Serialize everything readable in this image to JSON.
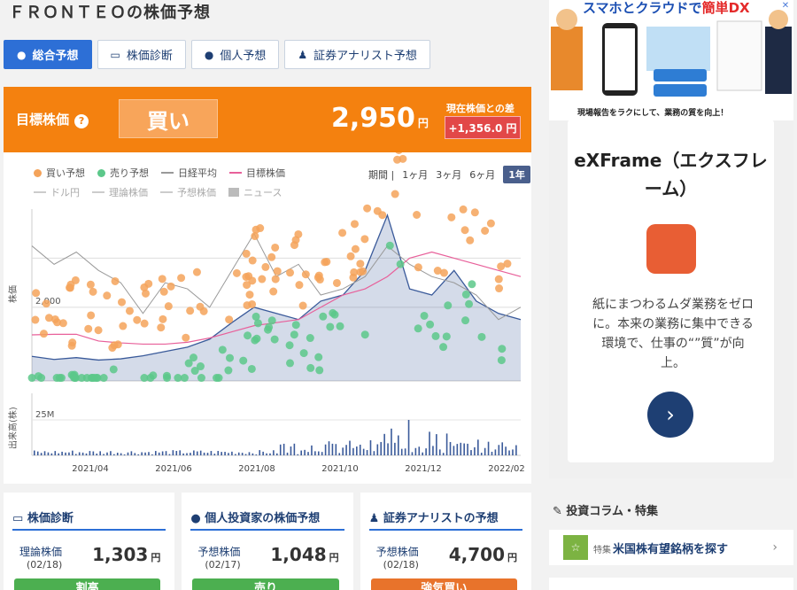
{
  "page_title": "ＦＲＯＮＴＥＯの株価予想",
  "tabs": [
    {
      "label": "総合予想",
      "icon": "chat-icon"
    },
    {
      "label": "株価診断",
      "icon": "monitor-icon"
    },
    {
      "label": "個人予想",
      "icon": "chat-icon"
    },
    {
      "label": "証券アナリスト予想",
      "icon": "people-icon"
    }
  ],
  "target": {
    "label": "目標株価",
    "help": "?",
    "rating": "買い",
    "price": "2,950",
    "yen": "円",
    "diff_label": "現在株価との差",
    "diff": "+1,356.0 円"
  },
  "legend": {
    "row1": [
      "買い予想",
      "売り予想",
      "日経平均",
      "目標株価"
    ],
    "row2": [
      "ドル円",
      "理論株価",
      "予想株価",
      "ニュース"
    ]
  },
  "period": {
    "label": "期間 |",
    "options": [
      "1ヶ月",
      "3ヶ月",
      "6ヶ月",
      "1年"
    ],
    "selected": "1年"
  },
  "chart_data": {
    "type": "line",
    "y_label": "株価",
    "y_tick": "2,000",
    "volume_label": "出来高(株)",
    "volume_tick": "25M",
    "x_ticks": [
      "2021/04",
      "2021/06",
      "2021/08",
      "2021/10",
      "2021/12",
      "2022/02"
    ],
    "colors": {
      "buy": "#f4a35a",
      "sell": "#5cc88a",
      "nikkei": "#999999",
      "target": "#e8609a",
      "price": "#3a5a9a",
      "volume": "#3a5a9a"
    },
    "series": [
      {
        "name": "株価",
        "values": [
          1200,
          1150,
          1180,
          1140,
          1160,
          1210,
          1280,
          1350,
          1480,
          1750,
          2000,
          1900,
          1800,
          2100,
          2200,
          2600,
          3500,
          2300,
          2200,
          2600,
          2100,
          1900,
          1800
        ]
      },
      {
        "name": "目標株価",
        "values": [
          1550,
          1560,
          1560,
          1450,
          1420,
          1400,
          1400,
          1430,
          1500,
          1600,
          1700,
          1750,
          1800,
          2000,
          2200,
          2300,
          2500,
          2800,
          2900,
          2800,
          2700,
          2600,
          2500
        ]
      },
      {
        "name": "日経平均",
        "values": [
          3000,
          2700,
          2900,
          2600,
          2400,
          1900,
          2400,
          2300,
          2000,
          2600,
          3200,
          2500,
          2700,
          2200,
          2300,
          2500,
          3000,
          2700,
          2500,
          2400,
          2200,
          1800,
          2000
        ]
      }
    ]
  },
  "cards": [
    {
      "title": "株価診断",
      "icon": "monitor-icon",
      "label": "理論株価",
      "date": "(02/18)",
      "value": "1,303",
      "unit": "円",
      "button": "割高",
      "button_color": "#4caf50"
    },
    {
      "title": "個人投資家の株価予想",
      "icon": "chat-icon",
      "label": "予想株価",
      "date": "(02/17)",
      "value": "1,048",
      "unit": "円",
      "button": "売り",
      "button_color": "#4caf50"
    },
    {
      "title": "証券アナリストの予想",
      "icon": "person-icon",
      "label": "予想株価",
      "date": "(02/18)",
      "value": "4,700",
      "unit": "円",
      "button": "強気買い",
      "button_color": "#e8732b"
    }
  ],
  "ad": {
    "banner_title_a": "スマホとクラウドで",
    "banner_title_b": "簡単DX",
    "banner_caption": "現場報告をラクにして、業務の質を向上！",
    "name": "eXFrame（エクスフレーム）",
    "text": "紙にまつわるムダ業務をゼロに。本来の業務に集中できる環境で、仕事の“”質”が向上。",
    "go": "›",
    "close": "✕"
  },
  "column": {
    "title": "投資コラム・特集",
    "item_tag": "特集",
    "item_label": "米国株有望銘柄を探す",
    "chevron": "›"
  }
}
